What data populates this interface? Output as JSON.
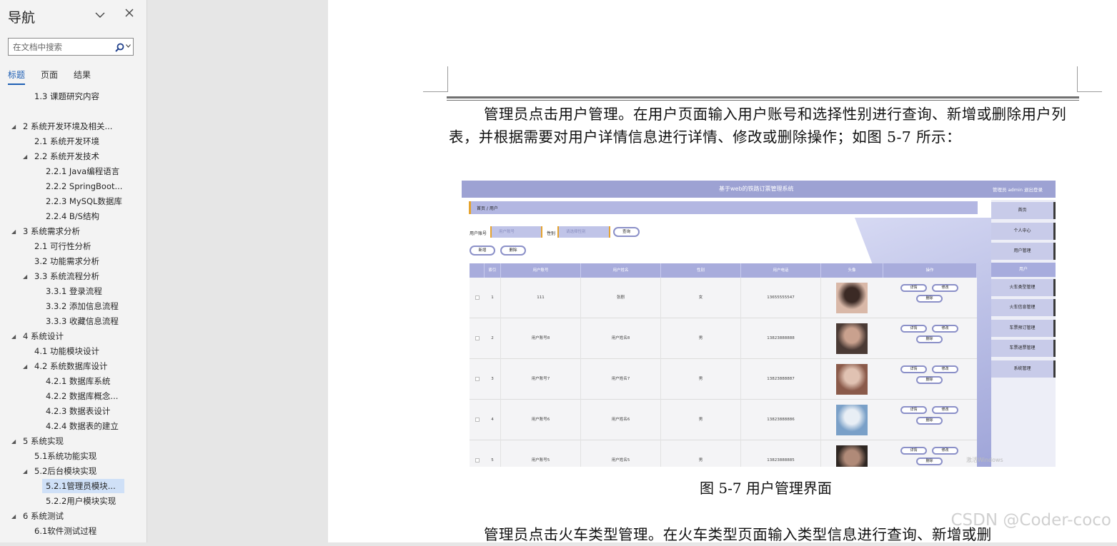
{
  "nav": {
    "title": "导航",
    "search_placeholder": "在文档中搜索",
    "tabs": [
      {
        "label": "标题",
        "active": true
      },
      {
        "label": "页面",
        "active": false
      },
      {
        "label": "结果",
        "active": false
      }
    ],
    "items": [
      {
        "label": "1.3 课题研究内容",
        "level": 2,
        "expanded": null,
        "selected": false
      },
      {
        "label": "2 系统开发环境及相关...",
        "level": 1,
        "expanded": true,
        "selected": false
      },
      {
        "label": "2.1 系统开发环境",
        "level": 2,
        "expanded": null,
        "selected": false
      },
      {
        "label": "2.2 系统开发技术",
        "level": 2,
        "expanded": true,
        "selected": false
      },
      {
        "label": "2.2.1 Java编程语言",
        "level": 3,
        "expanded": null,
        "selected": false
      },
      {
        "label": "2.2.2 SpringBoot...",
        "level": 3,
        "expanded": null,
        "selected": false
      },
      {
        "label": "2.2.3 MySQL数据库",
        "level": 3,
        "expanded": null,
        "selected": false
      },
      {
        "label": "2.2.4 B/S结构",
        "level": 3,
        "expanded": null,
        "selected": false
      },
      {
        "label": "3 系统需求分析",
        "level": 1,
        "expanded": true,
        "selected": false
      },
      {
        "label": "2.1 可行性分析",
        "level": 2,
        "expanded": null,
        "selected": false
      },
      {
        "label": "3.2 功能需求分析",
        "level": 2,
        "expanded": null,
        "selected": false
      },
      {
        "label": "3.3 系统流程分析",
        "level": 2,
        "expanded": true,
        "selected": false
      },
      {
        "label": "3.3.1 登录流程",
        "level": 3,
        "expanded": null,
        "selected": false
      },
      {
        "label": "3.3.2 添加信息流程",
        "level": 3,
        "expanded": null,
        "selected": false
      },
      {
        "label": "3.3.3 收藏信息流程",
        "level": 3,
        "expanded": null,
        "selected": false
      },
      {
        "label": "4 系统设计",
        "level": 1,
        "expanded": true,
        "selected": false
      },
      {
        "label": "4.1 功能模块设计",
        "level": 2,
        "expanded": null,
        "selected": false
      },
      {
        "label": "4.2 系统数据库设计",
        "level": 2,
        "expanded": true,
        "selected": false
      },
      {
        "label": "4.2.1 数据库系统",
        "level": 3,
        "expanded": null,
        "selected": false
      },
      {
        "label": "4.2.2 数据库概念...",
        "level": 3,
        "expanded": null,
        "selected": false
      },
      {
        "label": "4.2.3 数据表设计",
        "level": 3,
        "expanded": null,
        "selected": false
      },
      {
        "label": "4.2.4 数据表的建立",
        "level": 3,
        "expanded": null,
        "selected": false
      },
      {
        "label": "5 系统实现",
        "level": 1,
        "expanded": true,
        "selected": false
      },
      {
        "label": "5.1系统功能实现",
        "level": 2,
        "expanded": null,
        "selected": false
      },
      {
        "label": "5.2后台模块实现",
        "level": 2,
        "expanded": true,
        "selected": false
      },
      {
        "label": "5.2.1管理员模块...",
        "level": 3,
        "expanded": null,
        "selected": true
      },
      {
        "label": "5.2.2用户模块实现",
        "level": 3,
        "expanded": null,
        "selected": false
      },
      {
        "label": "6 系统测试",
        "level": 1,
        "expanded": true,
        "selected": false
      },
      {
        "label": "6.1软件测试过程",
        "level": 2,
        "expanded": null,
        "selected": false
      }
    ]
  },
  "doc": {
    "para1": "管理员点击用户管理。在用户页面输入用户账号和选择性别进行查询、新增或删除用户列表，并根据需要对用户详情信息进行详情、修改或删除操作；如图 5-7 所示：",
    "caption": "图 5-7 用户管理界面",
    "para2": "管理员点击火车类型管理。在火车类型页面输入类型信息进行查询、新增或删",
    "watermark": "CSDN @Coder-coco"
  },
  "shot": {
    "app_title": "基于web的铁路订票管理系统",
    "user_info": "管理员 admin  退出登录",
    "breadcrumb": "首页 / 用户",
    "label_account": "用户账号",
    "placeholder_account": "用户账号",
    "label_gender": "性别",
    "placeholder_gender": "请选择性别",
    "btn_query": "查询",
    "btn_add": "新增",
    "btn_delete": "删除",
    "columns": [
      "",
      "索引",
      "用户账号",
      "用户姓名",
      "性别",
      "用户电话",
      "头像",
      "操作"
    ],
    "rows": [
      {
        "idx": "1",
        "account": "111",
        "name": "张剧",
        "gender": "女",
        "phone": "13655555547"
      },
      {
        "idx": "2",
        "account": "用户账号8",
        "name": "用户姓名8",
        "gender": "男",
        "phone": "13823888888"
      },
      {
        "idx": "3",
        "account": "用户账号7",
        "name": "用户姓名7",
        "gender": "男",
        "phone": "13823888887"
      },
      {
        "idx": "4",
        "account": "用户账号6",
        "name": "用户姓名6",
        "gender": "男",
        "phone": "13823888886"
      },
      {
        "idx": "5",
        "account": "用户账号5",
        "name": "用户姓名5",
        "gender": "男",
        "phone": "13823888885"
      }
    ],
    "row_actions": [
      "详情",
      "修改",
      "删除"
    ],
    "side_menu": [
      "首页",
      "个人中心",
      "用户管理",
      "用户",
      "火车类型管理",
      "火车信息管理",
      "车票预订管理",
      "车票退票管理",
      "系统管理"
    ],
    "activation_text": "激活Windows"
  },
  "colors": {
    "accent": "#1e5fb4",
    "header": "#9da2d3",
    "menu": "#c8cbe9",
    "selected": "#cfe0f7"
  }
}
